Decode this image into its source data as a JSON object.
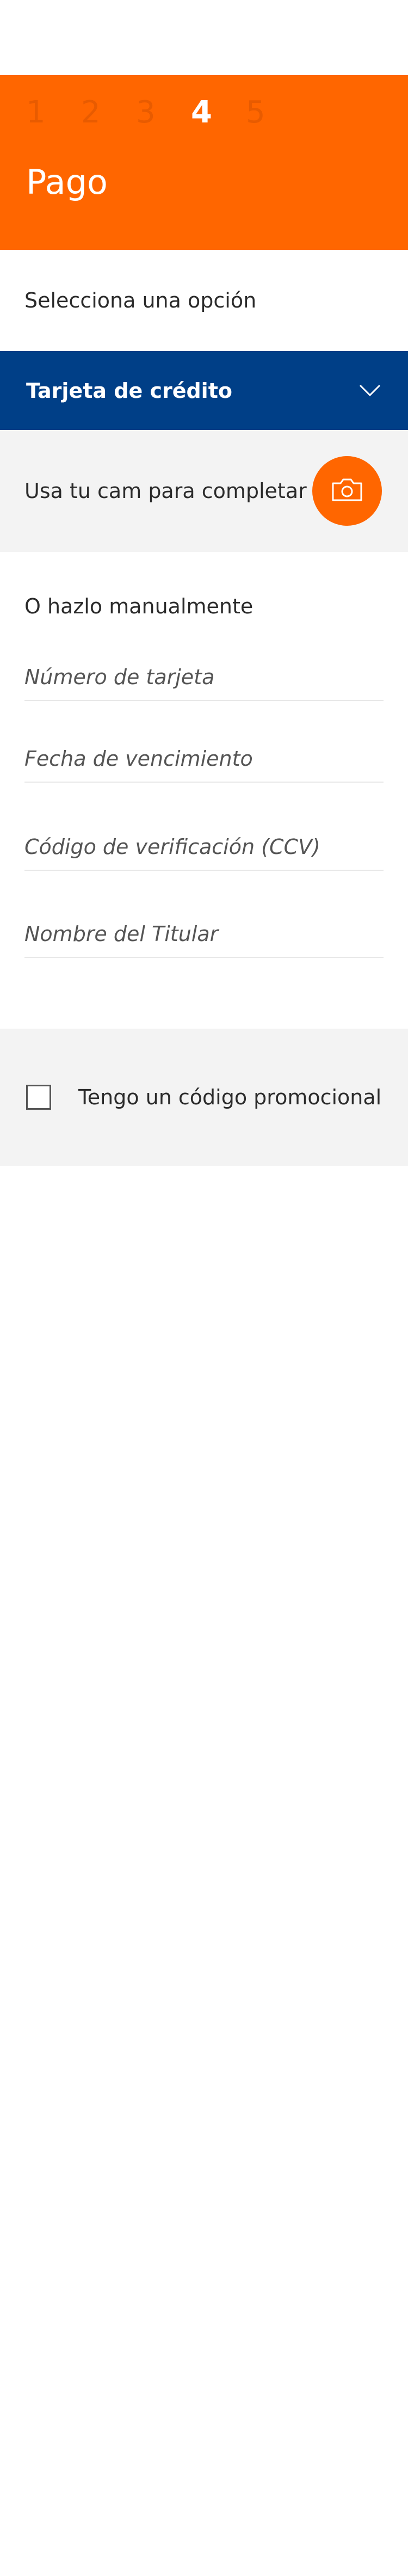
{
  "steps": {
    "items": [
      "1",
      "2",
      "3",
      "4",
      "5"
    ],
    "active_index": 3
  },
  "page_title": "Pago",
  "payment": {
    "select_label": "Selecciona una opción",
    "selected_option": "Tarjeta de crédito",
    "camera_text": "Usa tu cam para completar",
    "manual_label": "O hazlo manualmente"
  },
  "fields": {
    "card_number_placeholder": "Número de tarjeta",
    "expiry_placeholder": "Fecha de vencimiento",
    "ccv_placeholder": "Código de verificación (CCV)",
    "holder_placeholder": "Nombre del Titular"
  },
  "promo": {
    "label": "Tengo un código promocional",
    "checked": false
  },
  "colors": {
    "brand_orange": "#ff6600",
    "brand_blue": "#003f87",
    "panel_gray": "#f3f3f3"
  },
  "icons": {
    "dropdown": "chevron-down-icon",
    "camera": "camera-icon"
  }
}
